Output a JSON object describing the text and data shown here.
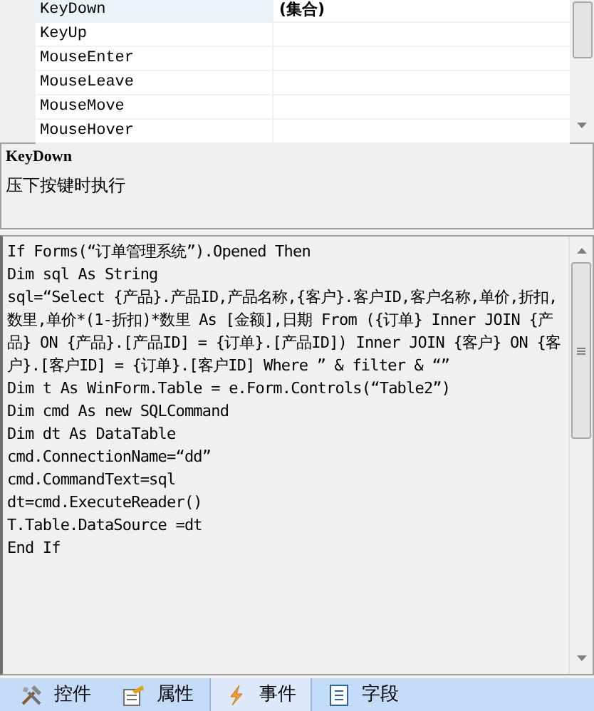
{
  "event_grid": {
    "rows": [
      {
        "name": "KeyDown",
        "value": "(集合)",
        "selected": true
      },
      {
        "name": "KeyUp",
        "selected": false
      },
      {
        "name": "MouseEnter",
        "selected": false
      },
      {
        "name": "MouseLeave",
        "selected": false
      },
      {
        "name": "MouseMove",
        "selected": false
      },
      {
        "name": "MouseHover",
        "selected": false
      }
    ]
  },
  "description": {
    "title": "KeyDown",
    "text": "压下按键时执行"
  },
  "code_editor": {
    "lines": [
      "If Forms(“订单管理系统”).Opened Then",
      "Dim sql As String",
      "sql=“Select {产品}.产品ID,产品名称,{客户}.客户ID,客户名称,单价,折扣,数里,单价*(1-折扣)*数里 As [金额],日期 From ({订单} Inner JOIN {产品} ON {产品}.[产品ID] = {订单}.[产品ID]) Inner JOIN {客户} ON {客户}.[客户ID] = {订单}.[客户ID] Where ” & filter & “”",
      "Dim t As WinForm.Table = e.Form.Controls(“Table2”)",
      "Dim cmd As new SQLCommand",
      "Dim dt As DataTable",
      "cmd.ConnectionName=“dd”",
      "cmd.CommandText=sql",
      "dt=cmd.ExecuteReader()",
      "T.Table.DataSource =dt",
      "End If"
    ]
  },
  "tabs": [
    {
      "label": "控件",
      "kind": "tools",
      "selected": false
    },
    {
      "label": "属性",
      "kind": "properties",
      "selected": false
    },
    {
      "label": "事件",
      "kind": "events",
      "selected": true
    },
    {
      "label": "字段",
      "kind": "fields",
      "selected": false
    }
  ]
}
